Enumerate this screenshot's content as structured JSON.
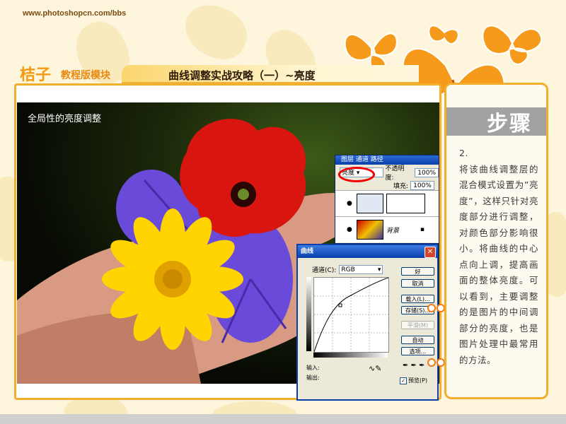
{
  "site": {
    "url": "www.photoshopcn.com/bbs"
  },
  "header": {
    "brand": "桔子",
    "brand_sub": "教程版模块",
    "title": "曲线调整实战攻略（一）~亮度"
  },
  "main": {
    "photo_caption": "全局性的亮度调整"
  },
  "side_panel": {
    "heading": "步骤",
    "step_number": "2.",
    "text": "将该曲线调整层的混合模式设置为”亮度”，这样只针对亮度部分进行调整，对颜色部分影响很小。将曲线的中心点向上调，提高画面的整体亮度。可以看到，主要调整的是图片的中间调部分的亮度，也是图片处理中最常用的方法。"
  },
  "layers_panel": {
    "tabs": [
      "图层",
      "通道",
      "路径"
    ],
    "blend_mode": "亮度",
    "opacity_label": "不透明度:",
    "opacity_value": "100%",
    "fill_label": "填充:",
    "fill_value": "100%",
    "layers": [
      {
        "name": ""
      },
      {
        "name": "背景"
      }
    ]
  },
  "curves_dialog": {
    "title": "曲线",
    "channel_label": "通道(C):",
    "channel_value": "RGB",
    "buttons": {
      "ok": "好",
      "cancel": "取消",
      "load": "载入(L)...",
      "save": "存储(S)...",
      "smooth": "平滑(M)",
      "auto": "自动",
      "options": "选项..."
    },
    "input_label": "输入:",
    "output_label": "输出:",
    "preview_label": "预览(P)"
  },
  "colors": {
    "accent_orange": "#f3ae2d",
    "brand_orange": "#f39a16",
    "dialog_blue": "#0a3fa8"
  }
}
